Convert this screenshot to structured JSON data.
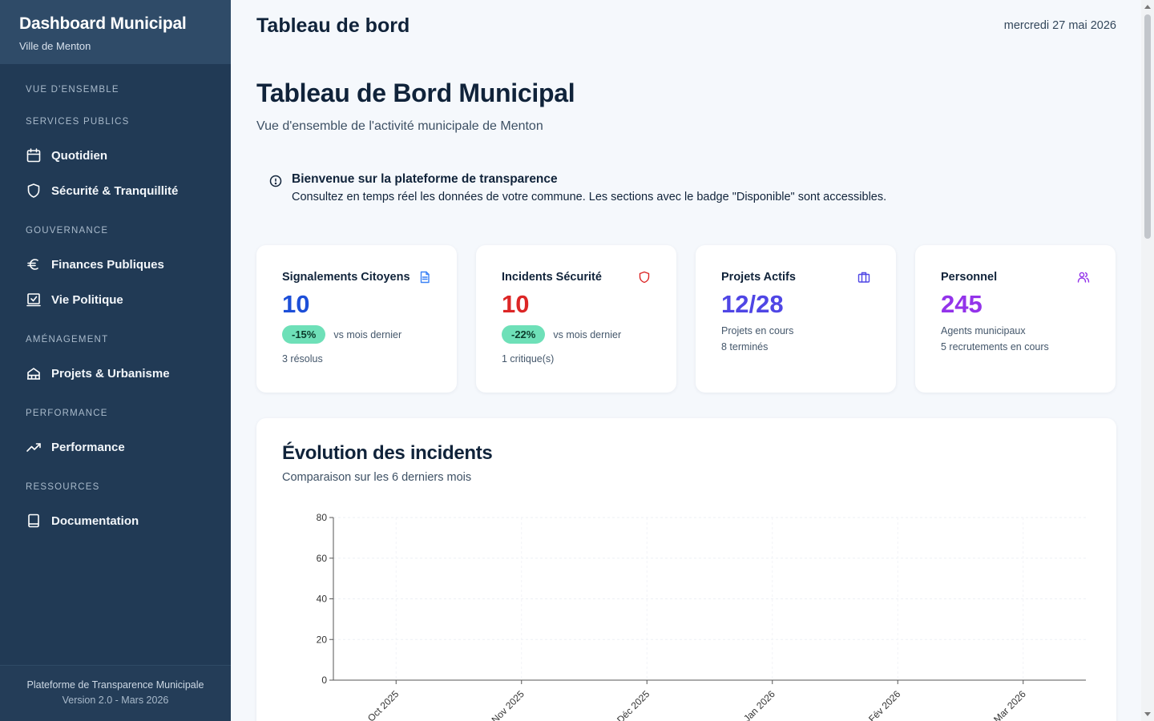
{
  "sidebar": {
    "title": "Dashboard Municipal",
    "subtitle": "Ville de Menton",
    "sections": [
      {
        "label": "VUE D'ENSEMBLE",
        "items": []
      },
      {
        "label": "SERVICES PUBLICS",
        "items": [
          {
            "label": "Quotidien",
            "icon": "calendar-icon"
          },
          {
            "label": "Sécurité & Tranquillité",
            "icon": "shield-icon"
          }
        ]
      },
      {
        "label": "GOUVERNANCE",
        "items": [
          {
            "label": "Finances Publiques",
            "icon": "euro-icon"
          },
          {
            "label": "Vie Politique",
            "icon": "vote-icon"
          }
        ]
      },
      {
        "label": "AMÉNAGEMENT",
        "items": [
          {
            "label": "Projets & Urbanisme",
            "icon": "building-icon"
          }
        ]
      },
      {
        "label": "PERFORMANCE",
        "items": [
          {
            "label": "Performance",
            "icon": "trending-up-icon"
          }
        ]
      },
      {
        "label": "RESSOURCES",
        "items": [
          {
            "label": "Documentation",
            "icon": "book-icon"
          }
        ]
      }
    ],
    "footer": {
      "line1": "Plateforme de Transparence Municipale",
      "line2": "Version 2.0 - Mars 2026"
    }
  },
  "header": {
    "title": "Tableau de bord",
    "date": "mercredi 27 mai 2026"
  },
  "page": {
    "title": "Tableau de Bord Municipal",
    "subtitle": "Vue d'ensemble de l'activité municipale de Menton"
  },
  "banner": {
    "icon": "info-icon",
    "title": "Bienvenue sur la plateforme de transparence",
    "text": "Consultez en temps réel les données de votre commune. Les sections avec le badge \"Disponible\" sont accessibles."
  },
  "cards": [
    {
      "title": "Signalements Citoyens",
      "icon": "document-icon",
      "icon_color": "#3b82f6",
      "value": "10",
      "value_color": "#1d4fd8",
      "badge": "-15%",
      "badge_note": "vs mois dernier",
      "line1": "3 résolus",
      "line2": ""
    },
    {
      "title": "Incidents Sécurité",
      "icon": "shield-icon",
      "icon_color": "#dc2626",
      "value": "10",
      "value_color": "#dc2626",
      "badge": "-22%",
      "badge_note": "vs mois dernier",
      "line1": "1 critique(s)",
      "line2": ""
    },
    {
      "title": "Projets Actifs",
      "icon": "briefcase-icon",
      "icon_color": "#4f46e5",
      "value": "12/28",
      "value_color": "#4f46e5",
      "badge": "",
      "badge_note": "",
      "line1": "Projets en cours",
      "line2": "8 terminés"
    },
    {
      "title": "Personnel",
      "icon": "users-icon",
      "icon_color": "#9333ea",
      "value": "245",
      "value_color": "#9333ea",
      "badge": "",
      "badge_note": "",
      "line1": "Agents municipaux",
      "line2": "5 recrutements en cours"
    }
  ],
  "chart": {
    "title": "Évolution des incidents",
    "subtitle": "Comparaison sur les 6 derniers mois"
  },
  "chart_data": {
    "type": "line",
    "categories": [
      "Oct 2025",
      "Nov 2025",
      "Déc 2025",
      "Jan 2026",
      "Fév 2026",
      "Mar 2026"
    ],
    "series": [],
    "ylim": [
      0,
      80
    ],
    "yticks": [
      0,
      20,
      40,
      60,
      80
    ],
    "grid": true
  }
}
